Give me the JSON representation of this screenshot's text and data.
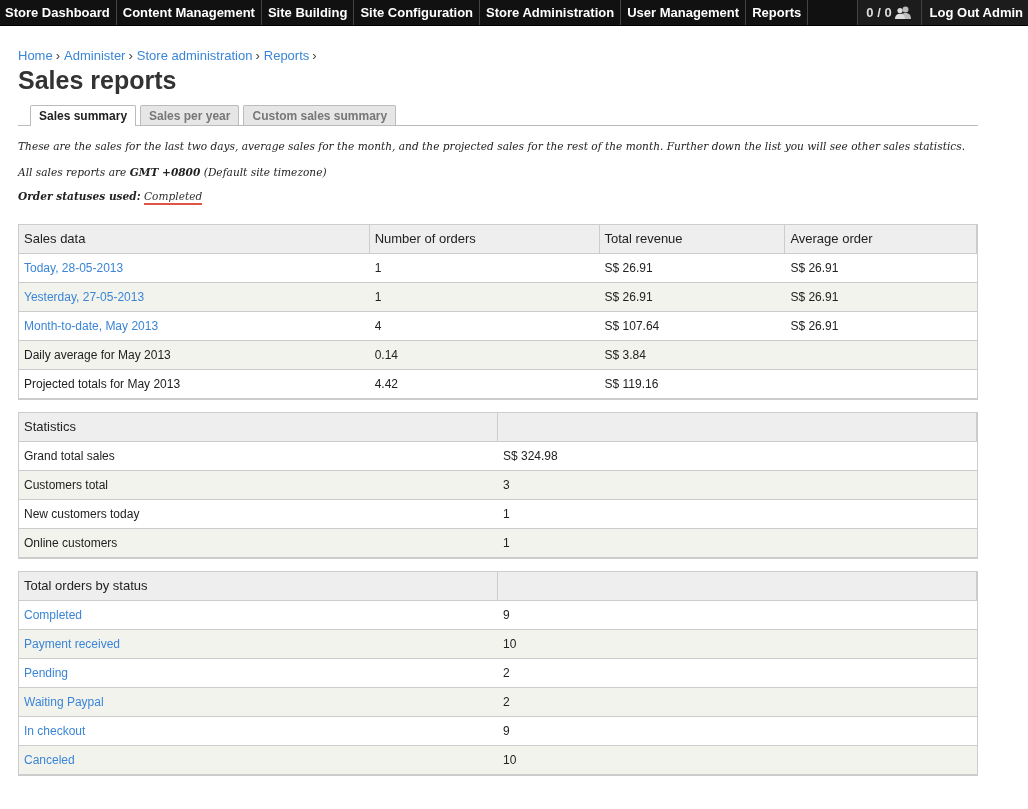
{
  "top_nav": {
    "items": [
      {
        "label": "Store Dashboard"
      },
      {
        "label": "Content Management"
      },
      {
        "label": "Site Building"
      },
      {
        "label": "Site Configuration"
      },
      {
        "label": "Store Administration"
      },
      {
        "label": "User Management"
      },
      {
        "label": "Reports"
      }
    ],
    "users_count": "0 / 0",
    "logout": "Log Out Admin"
  },
  "breadcrumb": {
    "separator": "›",
    "items": [
      "Home",
      "Administer",
      "Store administration",
      "Reports"
    ]
  },
  "page_title": "Sales reports",
  "tabs": [
    {
      "label": "Sales summary",
      "selected": true
    },
    {
      "label": "Sales per year",
      "selected": false
    },
    {
      "label": "Custom sales summary",
      "selected": false
    }
  ],
  "intro": "These are the sales for the last two days, average sales for the month, and the projected sales for the rest of the month. Further down the list you will see other sales statistics.",
  "timezone_note": "All sales reports are **GMT +0800** (Default site timezone)",
  "statuses_used": {
    "label": "Order statuses used:",
    "link": "Completed"
  },
  "tables": [
    {
      "columns": [
        "Sales data",
        "Number of orders",
        "Total revenue",
        "Average order"
      ],
      "rows": [
        [
          {
            "text": "Today, 28-05-2013",
            "link": true
          },
          {
            "text": "1",
            "link": false
          },
          {
            "text": "S$ 26.91",
            "link": false
          },
          {
            "text": "S$ 26.91",
            "link": false
          }
        ],
        [
          {
            "text": "Yesterday, 27-05-2013",
            "link": true
          },
          {
            "text": "1",
            "link": false
          },
          {
            "text": "S$ 26.91",
            "link": false
          },
          {
            "text": "S$ 26.91",
            "link": false
          }
        ],
        [
          {
            "text": "Month-to-date, May 2013",
            "link": true
          },
          {
            "text": "4",
            "link": false
          },
          {
            "text": "S$ 107.64",
            "link": false
          },
          {
            "text": "S$ 26.91",
            "link": false
          }
        ],
        [
          {
            "text": "Daily average for May 2013",
            "link": false
          },
          {
            "text": "0.14",
            "link": false
          },
          {
            "text": "S$ 3.84",
            "link": false
          }
        ],
        [
          {
            "text": "Projected totals for May 2013",
            "link": false
          },
          {
            "text": "4.42",
            "link": false
          },
          {
            "text": "S$ 119.16",
            "link": false
          }
        ]
      ]
    },
    {
      "columns": [
        "Statistics"
      ],
      "rows": [
        [
          {
            "text": "Grand total sales",
            "link": false
          },
          {
            "text": "S$ 324.98",
            "link": false
          }
        ],
        [
          {
            "text": "Customers total",
            "link": false
          },
          {
            "text": "3",
            "link": false
          }
        ],
        [
          {
            "text": "New customers today",
            "link": false
          },
          {
            "text": "1",
            "link": false
          }
        ],
        [
          {
            "text": "Online customers",
            "link": false
          },
          {
            "text": "1",
            "link": false
          }
        ]
      ]
    },
    {
      "columns": [
        "Total orders by status"
      ],
      "rows": [
        [
          {
            "text": "Completed",
            "link": true
          },
          {
            "text": "9",
            "link": false
          }
        ],
        [
          {
            "text": "Payment received",
            "link": true
          },
          {
            "text": "10",
            "link": false
          }
        ],
        [
          {
            "text": "Pending",
            "link": true
          },
          {
            "text": "2",
            "link": false
          }
        ],
        [
          {
            "text": "Waiting Paypal",
            "link": true
          },
          {
            "text": "2",
            "link": false
          }
        ],
        [
          {
            "text": "In checkout",
            "link": true
          },
          {
            "text": "9",
            "link": false
          }
        ],
        [
          {
            "text": "Canceled",
            "link": true
          },
          {
            "text": "10",
            "link": false
          }
        ]
      ]
    }
  ]
}
